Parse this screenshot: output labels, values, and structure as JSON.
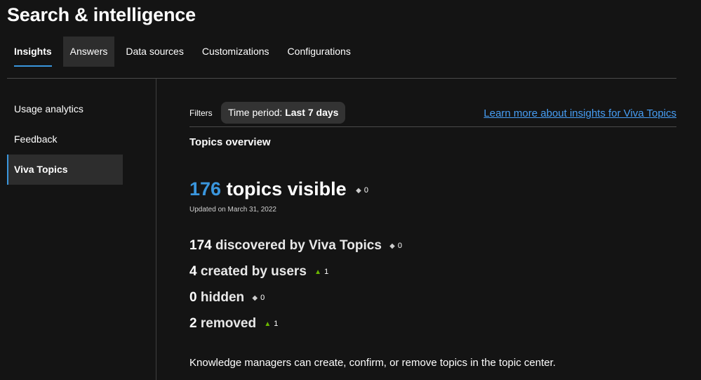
{
  "page_title": "Search & intelligence",
  "tabs": [
    {
      "label": "Insights",
      "state": "active"
    },
    {
      "label": "Answers",
      "state": "hover"
    },
    {
      "label": "Data sources",
      "state": "default"
    },
    {
      "label": "Customizations",
      "state": "default"
    },
    {
      "label": "Configurations",
      "state": "default"
    }
  ],
  "sidebar": {
    "items": [
      {
        "label": "Usage analytics"
      },
      {
        "label": "Feedback"
      },
      {
        "label": "Viva Topics",
        "selected": true
      }
    ]
  },
  "filters": {
    "label": "Filters",
    "time_period_prefix": "Time period:",
    "time_period_value": "Last 7 days"
  },
  "learn_more_link": "Learn more about insights for Viva Topics",
  "overview": {
    "title": "Topics overview",
    "visible_count": "176",
    "visible_label": "topics visible",
    "visible_delta": {
      "symbol": "◆",
      "value": "0",
      "trend": "flat"
    },
    "updated_text": "Updated on March 31, 2022",
    "stats": [
      {
        "number": "174",
        "label": "discovered by Viva Topics",
        "delta_symbol": "◆",
        "delta_value": "0",
        "trend": "flat"
      },
      {
        "number": "4",
        "label": "created by users",
        "delta_symbol": "▲",
        "delta_value": "1",
        "trend": "up"
      },
      {
        "number": "0",
        "label": "hidden",
        "delta_symbol": "◆",
        "delta_value": "0",
        "trend": "flat"
      },
      {
        "number": "2",
        "label": "removed",
        "delta_symbol": "▲",
        "delta_value": "1",
        "trend": "up"
      }
    ],
    "footnote": "Knowledge managers can create, confirm, or remove topics in the topic center."
  },
  "colors": {
    "accent": "#3a96dd",
    "link": "#479ef5",
    "trend_up": "#6bb700",
    "background": "#141414"
  }
}
